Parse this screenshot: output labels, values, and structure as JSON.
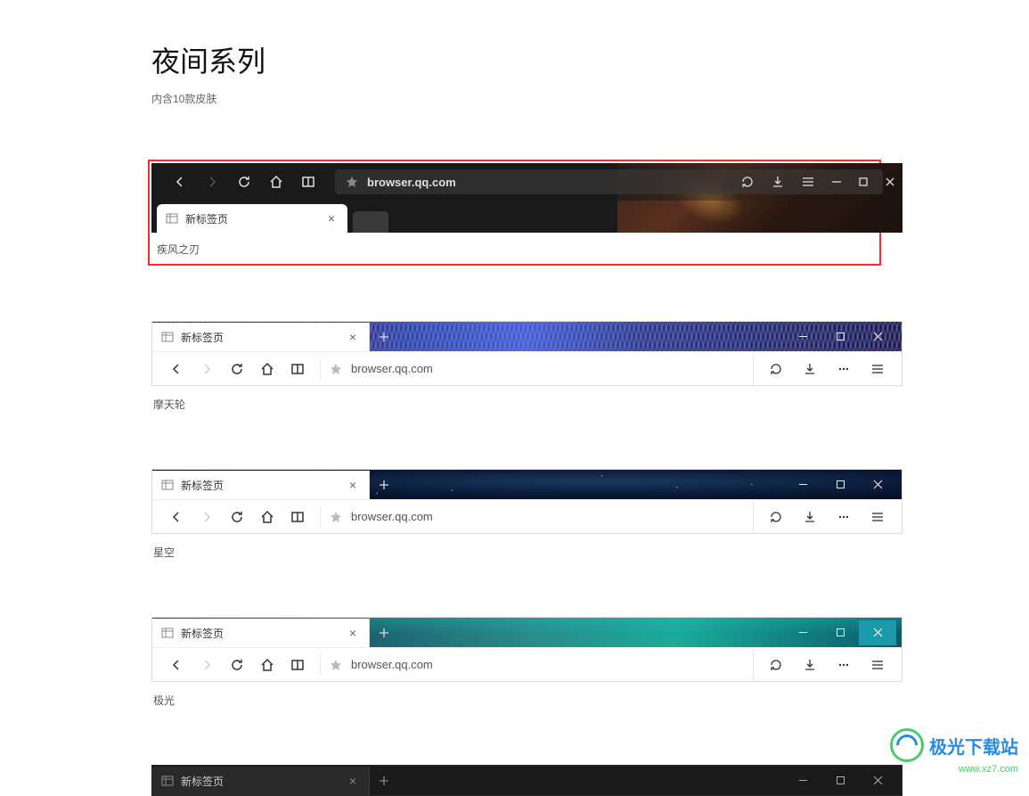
{
  "header": {
    "title": "夜间系列",
    "subtitle": "内含10款皮肤"
  },
  "tab_label": "新标签页",
  "url": "browser.qq.com",
  "themes": [
    {
      "name": "疾风之刃"
    },
    {
      "name": "摩天轮"
    },
    {
      "name": "星空"
    },
    {
      "name": "极光"
    }
  ],
  "watermark": {
    "name": "极光下载站",
    "url": "www.xz7.com"
  }
}
